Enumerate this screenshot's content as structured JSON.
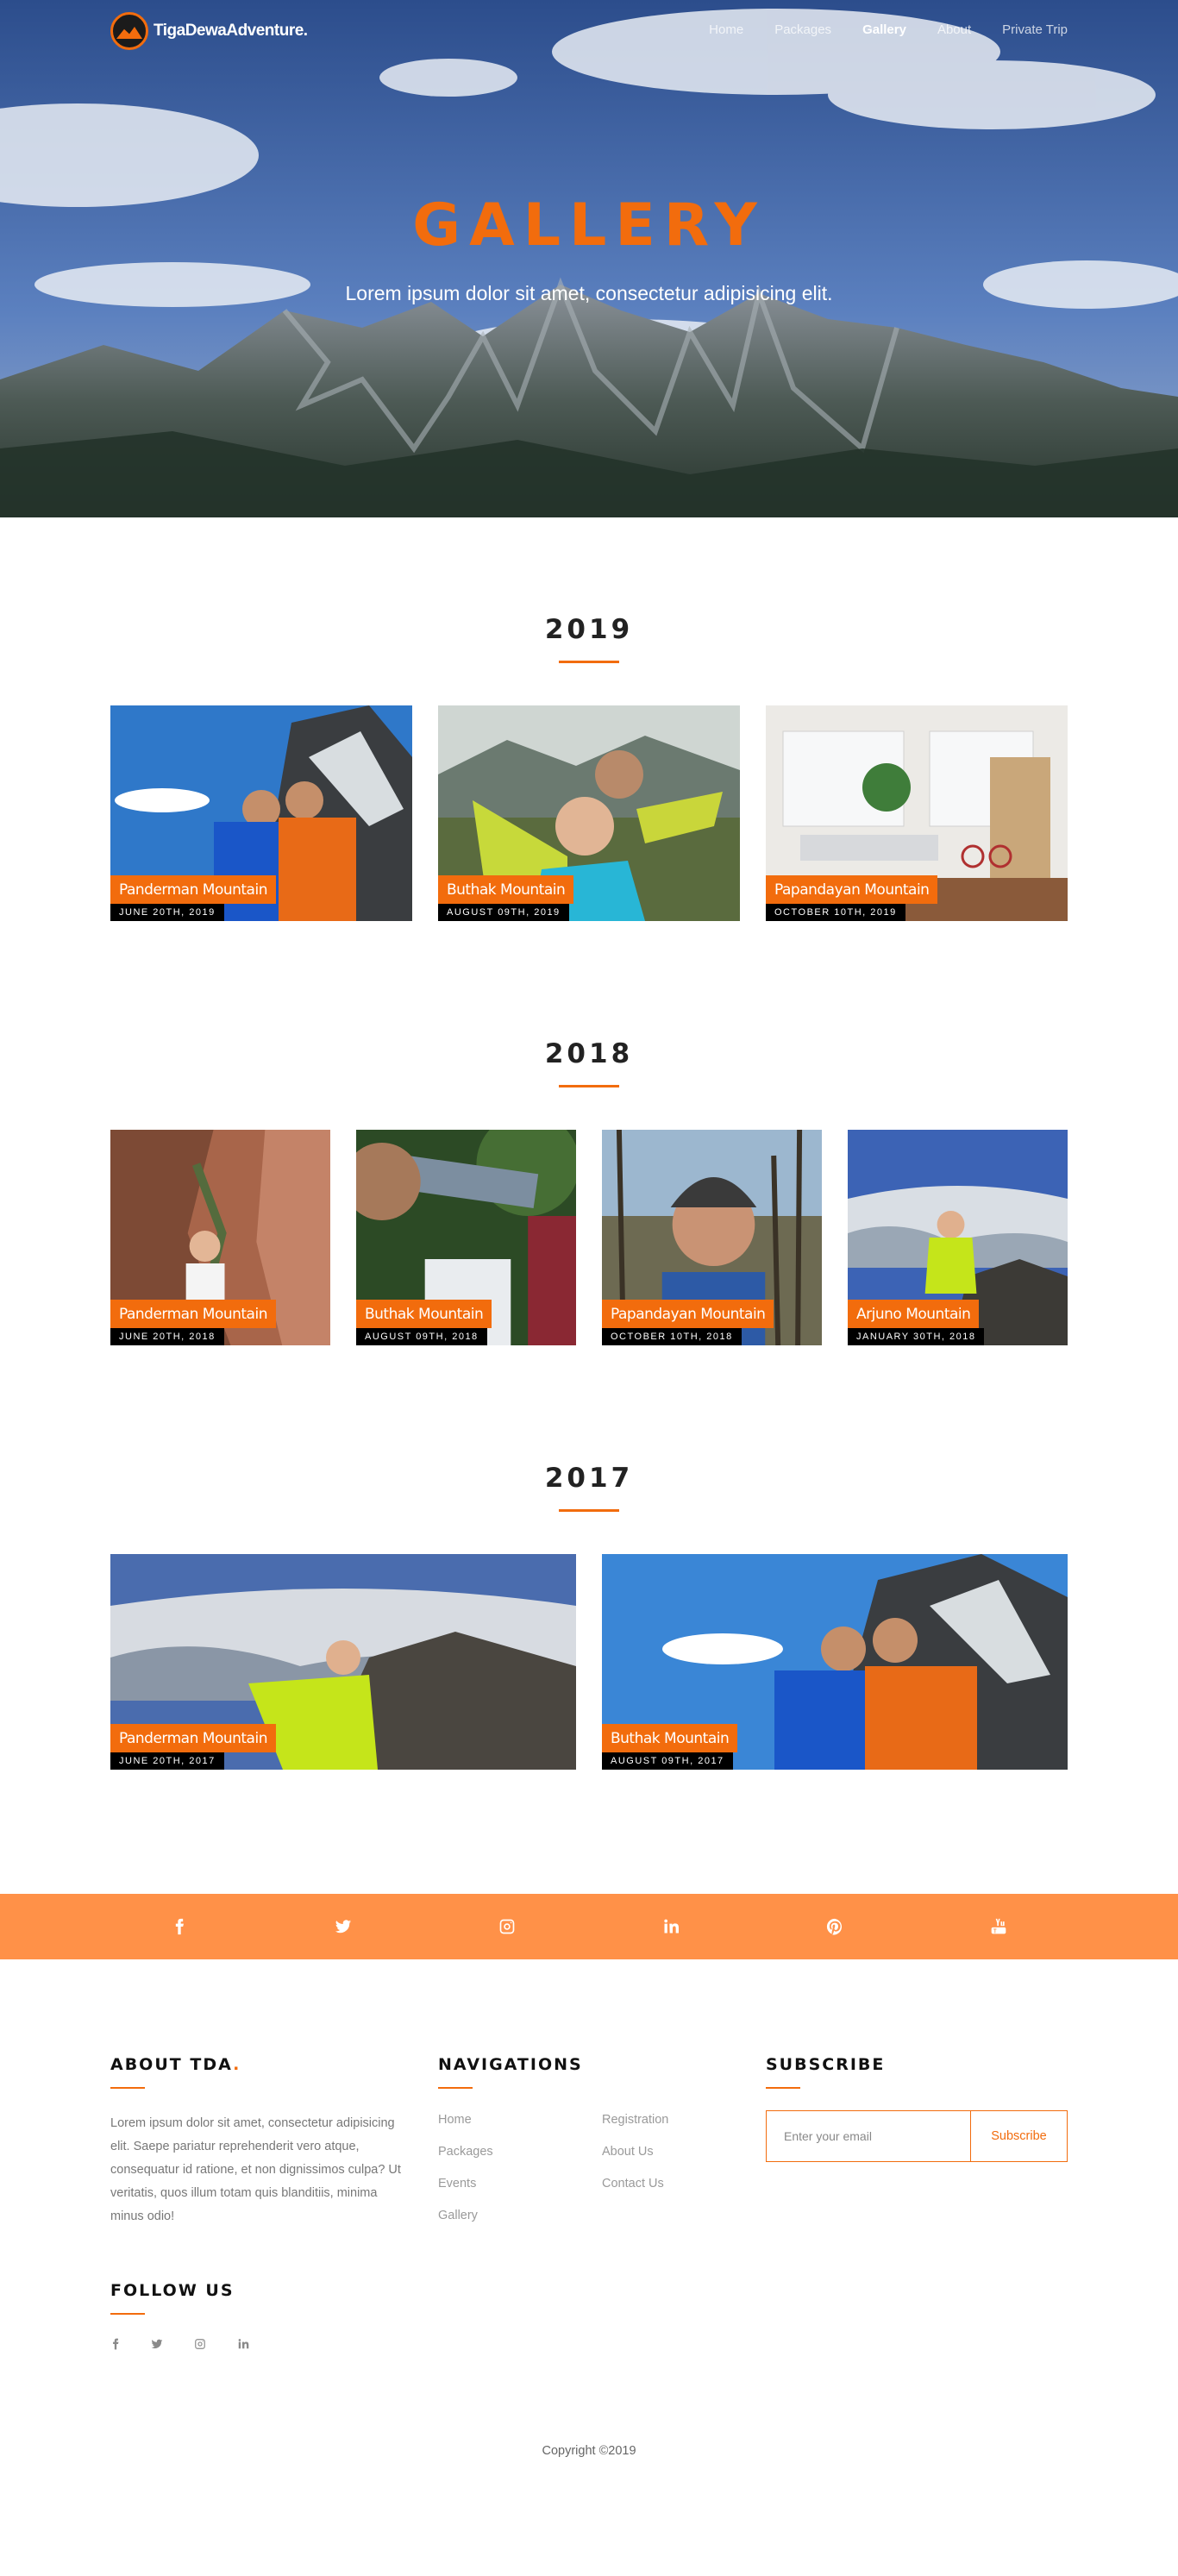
{
  "brand": {
    "name": "TigaDewaAdventure."
  },
  "nav": [
    {
      "label": "Home",
      "active": false
    },
    {
      "label": "Packages",
      "active": false
    },
    {
      "label": "Gallery",
      "active": true
    },
    {
      "label": "About",
      "active": false
    },
    {
      "label": "Private Trip",
      "active": false
    }
  ],
  "hero": {
    "title": "GALLERY",
    "subtitle": "Lorem ipsum dolor sit amet, consectetur adipisicing elit."
  },
  "gallery": [
    {
      "year": "2019",
      "items": [
        {
          "name": "Panderman Mountain",
          "date": "JUNE 20TH, 2019"
        },
        {
          "name": "Buthak Mountain",
          "date": "AUGUST 09TH, 2019"
        },
        {
          "name": "Papandayan Mountain",
          "date": "OCTOBER 10TH, 2019"
        }
      ]
    },
    {
      "year": "2018",
      "items": [
        {
          "name": "Panderman Mountain",
          "date": "JUNE 20TH, 2018"
        },
        {
          "name": "Buthak Mountain",
          "date": "AUGUST 09TH, 2018"
        },
        {
          "name": "Papandayan Mountain",
          "date": "OCTOBER 10TH, 2018"
        },
        {
          "name": "Arjuno Mountain",
          "date": "JANUARY 30TH, 2018"
        }
      ]
    },
    {
      "year": "2017",
      "items": [
        {
          "name": "Panderman Mountain",
          "date": "JUNE 20TH, 2017"
        },
        {
          "name": "Buthak Mountain",
          "date": "AUGUST 09TH, 2017"
        }
      ]
    }
  ],
  "social_bar": [
    "facebook-icon",
    "twitter-icon",
    "instagram-icon",
    "linkedin-icon",
    "pinterest-icon",
    "youtube-icon"
  ],
  "footer": {
    "about": {
      "heading_prefix": "ABOUT",
      "heading_brand": "TDA",
      "heading_dot": ".",
      "text": "Lorem ipsum dolor sit amet, consectetur adipisicing elit. Saepe pariatur reprehenderit vero atque, consequatur id ratione, et non dignissimos culpa? Ut veritatis, quos illum totam quis blanditiis, minima minus odio!"
    },
    "navigations": {
      "heading": "NAVIGATIONS",
      "col1": [
        "Home",
        "Packages",
        "Events",
        "Gallery"
      ],
      "col2": [
        "Registration",
        "About Us",
        "Contact Us"
      ]
    },
    "subscribe": {
      "heading": "SUBSCRIBE",
      "placeholder": "Enter your email",
      "button": "Subscribe"
    },
    "follow": {
      "heading": "FOLLOW US",
      "icons": [
        "facebook-icon",
        "twitter-icon",
        "instagram-icon",
        "linkedin-icon"
      ]
    },
    "copyright": "Copyright ©2019"
  },
  "colors": {
    "accent": "#f26c0d",
    "social_bar": "#ff9148"
  }
}
